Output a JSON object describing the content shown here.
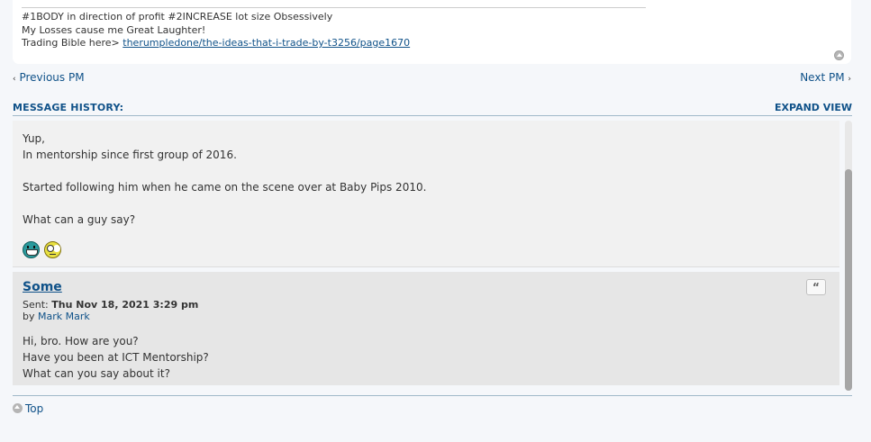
{
  "signature": {
    "line1": "#1BODY in direction of profit #2INCREASE lot size Obsessively",
    "line2": "My Losses cause me Great Laughter!",
    "line3_prefix": "Trading Bible here> ",
    "line3_link": "therumpledone/the-ideas-that-i-trade-by-t3256/page1670"
  },
  "nav": {
    "prev_label": "Previous PM",
    "next_label": "Next PM"
  },
  "history": {
    "title": "MESSAGE HISTORY:",
    "expand_label": "EXPAND VIEW",
    "messages": [
      {
        "lines": [
          "Yup,",
          "In mentorship since first group of 2016.",
          "",
          "Started following him when he came on the scene over at Baby Pips 2010.",
          "",
          "What can a guy say?"
        ],
        "smilies": [
          "grin-smiley-icon",
          "eek-smiley-icon"
        ]
      },
      {
        "subject": "Some",
        "sent_prefix": "Sent: ",
        "sent_date": "Thu Nov 18, 2021 3:29 pm",
        "by_prefix": "by ",
        "author": "Mark Mark",
        "quote_label": "“",
        "lines": [
          "Hi, bro. How are you?",
          "Have you been at ICT Mentorship?",
          "What can you say about it?"
        ]
      }
    ]
  },
  "footer": {
    "top_label": "Top"
  },
  "colors": {
    "link": "#105289",
    "page_bg": "#f5f7fa",
    "message_bg": "#f1f1f1",
    "message_alt_bg": "#e6e6e6"
  }
}
